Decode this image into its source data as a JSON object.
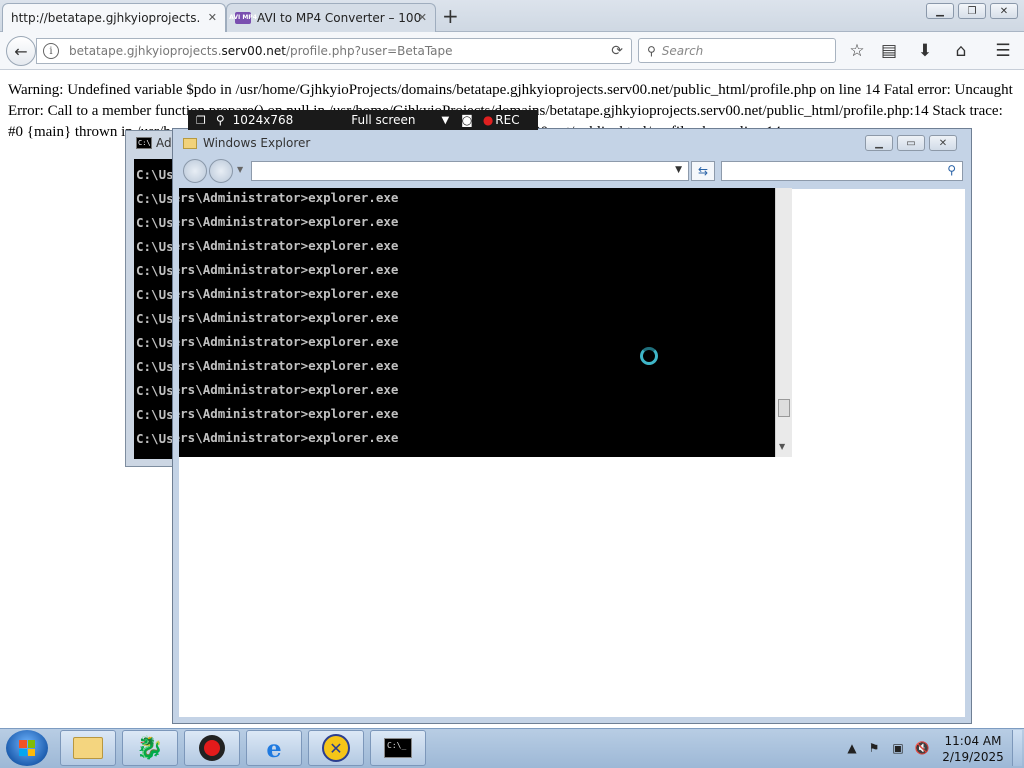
{
  "browser": {
    "tabs": [
      {
        "label": "http://betatape.gjhkyioprojects.",
        "active": true
      },
      {
        "label": "AVI to MP4 Converter – 100",
        "active": false
      }
    ],
    "url_muted_prefix": "betatape.gjhkyioprojects.",
    "url_domain": "serv00.net",
    "url_path": "/profile.php?user=BetaTape",
    "search_placeholder": "Search",
    "avi_favicon_text": "AVI MP4"
  },
  "page": {
    "error_text": "Warning: Undefined variable $pdo in /usr/home/GjhkyioProjects/domains/betatape.gjhkyioprojects.serv00.net/public_html/profile.php on line 14 Fatal error: Uncaught Error: Call to a member function prepare() on null in /usr/home/GjhkyioProjects/domains/betatape.gjhkyioprojects.serv00.net/public_html/profile.php:14 Stack trace: #0 {main} thrown in /usr/home/GjhkyioProjects/domains/betatape.gjhkyioprojects.serv00.net/public_html/profile.php on line 14"
  },
  "recorder": {
    "resolution": "1024x768",
    "mode": "Full screen",
    "rec_label": "REC"
  },
  "console": {
    "title": "Administrator: C:\\Windows\\system32\\cmd.exe",
    "prompt_line": "C:\\Users\\Administrator>explorer.exe",
    "lines": [
      "C:\\Users\\Administrator>",
      "C:\\Users\\Administrator>explorer.exe",
      "C:\\Users\\Administrator>explorer.exe",
      "C:\\Users\\Administrator>explorer.exe",
      "C:\\Users\\Administrator>explorer.exe",
      "C:\\Users\\Administrator>explorer.exe",
      "C:\\Users\\Administrator>explorer.exe",
      "C:\\Users\\Administrator>explorer.exe",
      "C:\\Users\\Administrator>explorer.exe",
      "C:\\Users\\Administrator>explorer.exe",
      "C:\\Users\\Administrator>explorer.exe",
      "C:\\Users\\Administrator>explorer.exe"
    ]
  },
  "explorer": {
    "title": "Windows Explorer"
  },
  "taskbar": {
    "time": "11:04 AM",
    "date": "2/19/2025"
  },
  "colors": {
    "rec_dot": "#e02020",
    "spinner": "#3fb6c8"
  }
}
